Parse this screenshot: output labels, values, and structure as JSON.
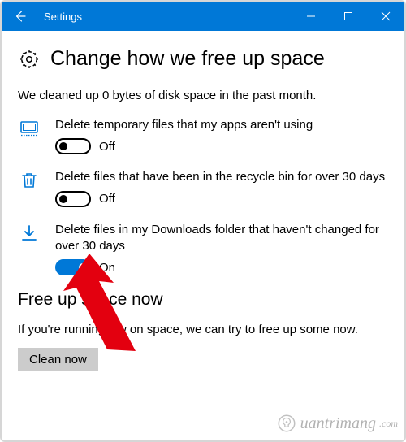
{
  "window": {
    "title": "Settings"
  },
  "header": {
    "title": "Change how we free up space"
  },
  "summary": "We cleaned up 0 bytes of disk space in the past month.",
  "options": [
    {
      "label": "Delete temporary files that my apps aren't using",
      "state": "Off",
      "on": false
    },
    {
      "label": "Delete files that have been in the recycle bin for over 30 days",
      "state": "Off",
      "on": false
    },
    {
      "label": "Delete files in my Downloads folder that haven't changed for over 30 days",
      "state": "On",
      "on": true
    }
  ],
  "section": {
    "title": "Free up space now",
    "desc": "If you're running low on space, we can try to free up some now.",
    "button": "Clean now"
  },
  "watermark": "uantrimang"
}
